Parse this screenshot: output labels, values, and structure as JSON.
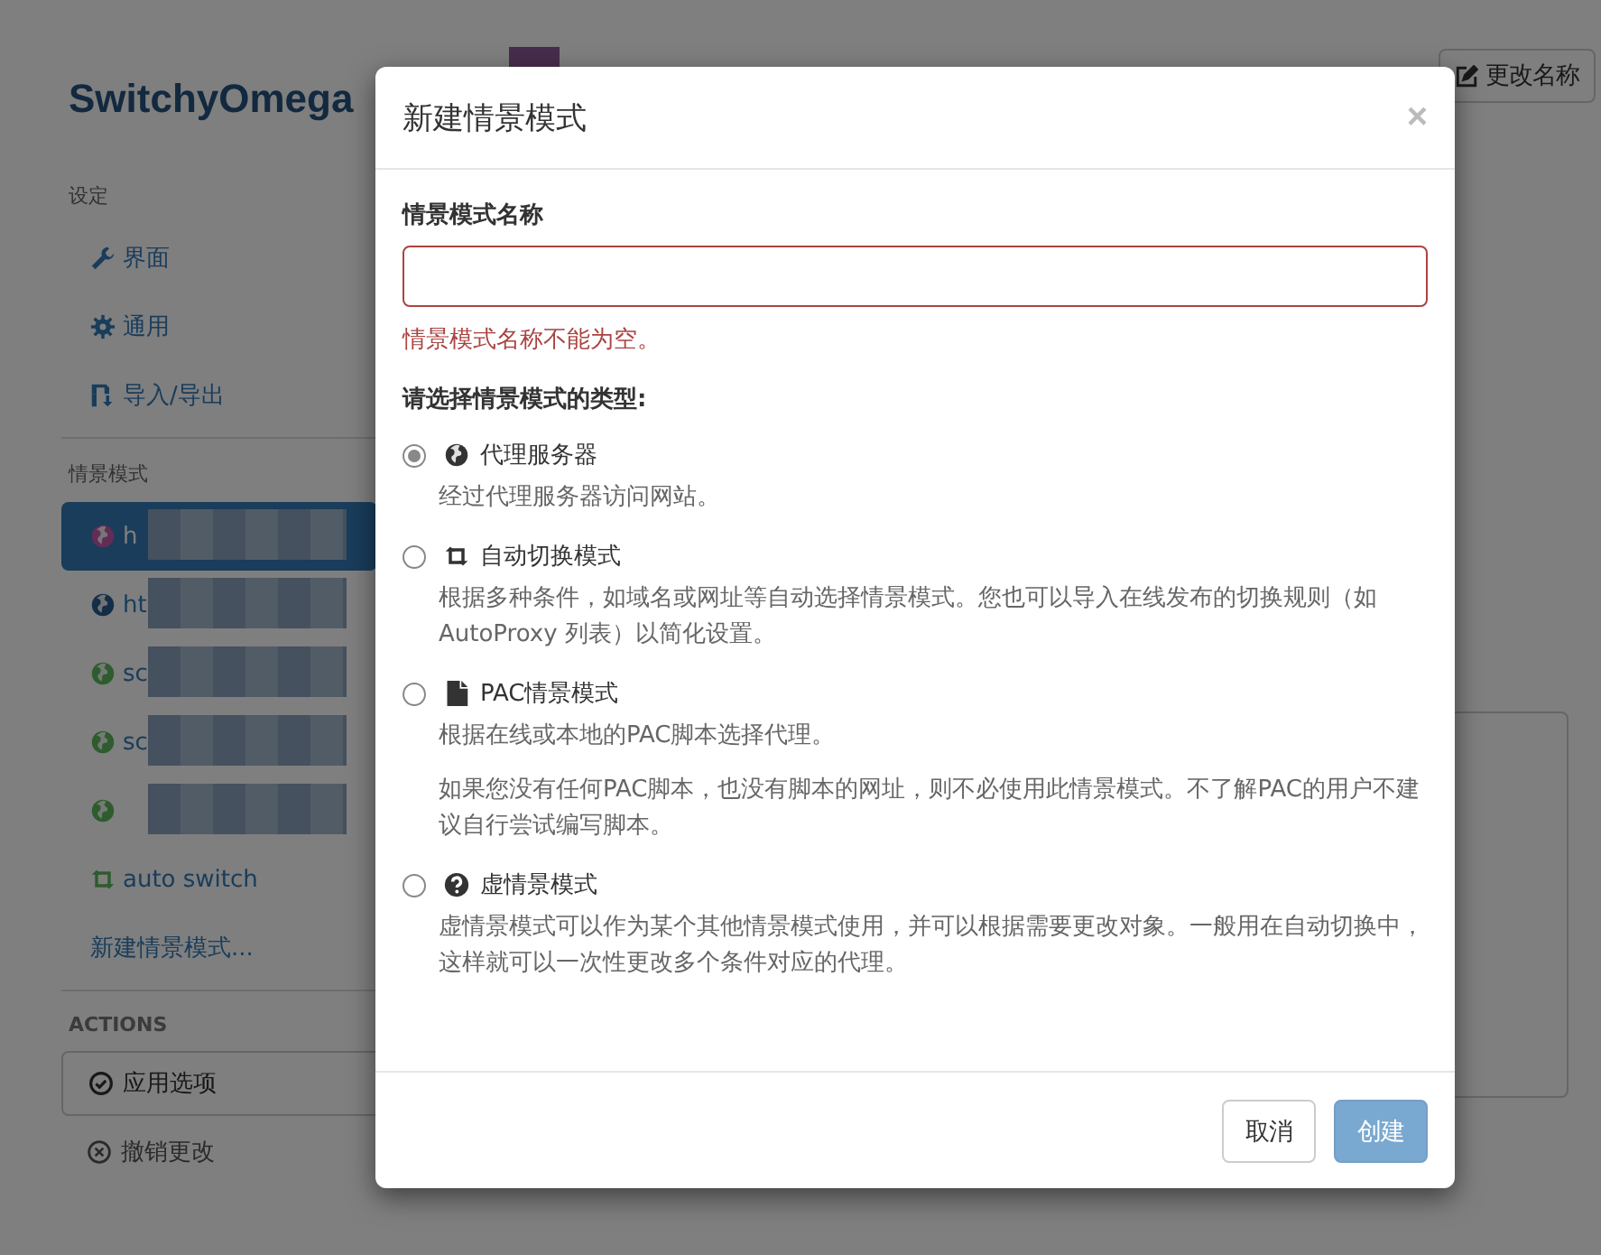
{
  "app": {
    "title": "SwitchyOmega",
    "rename_button": "更改名称"
  },
  "sidebar": {
    "sections": [
      {
        "heading": "设定",
        "items": [
          {
            "kind": "wrench",
            "label": "界面",
            "selected": false
          },
          {
            "kind": "gear",
            "label": "通用",
            "selected": false
          },
          {
            "kind": "import",
            "label": "导入/导出",
            "selected": false
          }
        ]
      },
      {
        "heading": "情景模式",
        "items": [
          {
            "kind": "profile",
            "label": "h",
            "selected": true
          },
          {
            "kind": "profile",
            "label": "ht",
            "selected": false
          },
          {
            "kind": "profile",
            "label": "sc",
            "selected": false
          },
          {
            "kind": "profile",
            "label": "sc",
            "selected": false
          },
          {
            "kind": "profile",
            "selected": false
          },
          {
            "kind": "switch",
            "label": "auto switch",
            "selected": false
          },
          {
            "kind": "add",
            "label": "新建情景模式...",
            "selected": false
          }
        ]
      }
    ],
    "actions_heading": "ACTIONS",
    "actions": [
      {
        "kind": "apply",
        "label": "应用选项"
      },
      {
        "kind": "discard",
        "label": "撤销更改"
      }
    ]
  },
  "dialog": {
    "title": "新建情景模式",
    "close": "×",
    "name_label": "情景模式名称",
    "name_invalid": true,
    "name_error": "情景模式名称不能为空。",
    "type_heading": "请选择情景模式的类型:",
    "options": [
      {
        "kind": "globe",
        "label": "代理服务器",
        "selected": true,
        "descriptions": [
          "经过代理服务器访问网站。"
        ]
      },
      {
        "kind": "switch",
        "label": "自动切换模式",
        "selected": false,
        "descriptions": [
          "根据多种条件，如域名或网址等自动选择情景模式。您也可以导入在线发布的切换规则（如 AutoProxy 列表）以简化设置。"
        ]
      },
      {
        "kind": "file",
        "label": "PAC情景模式",
        "selected": false,
        "descriptions": [
          "根据在线或本地的PAC脚本选择代理。",
          "如果您没有任何PAC脚本，也没有脚本的网址，则不必使用此情景模式。不了解PAC的用户不建议自行尝试编写脚本。"
        ]
      },
      {
        "kind": "question",
        "label": "虚情景模式",
        "selected": false,
        "descriptions": [
          "虚情景模式可以作为某个其他情景模式使用，并可以根据需要更改对象。一般用在自动切换中，这样就可以一次性更改多个条件对应的代理。"
        ]
      }
    ],
    "buttons": [
      {
        "kind": "cancel",
        "label": "取消",
        "disabled": false
      },
      {
        "kind": "create",
        "label": "创建",
        "disabled": true
      }
    ]
  }
}
